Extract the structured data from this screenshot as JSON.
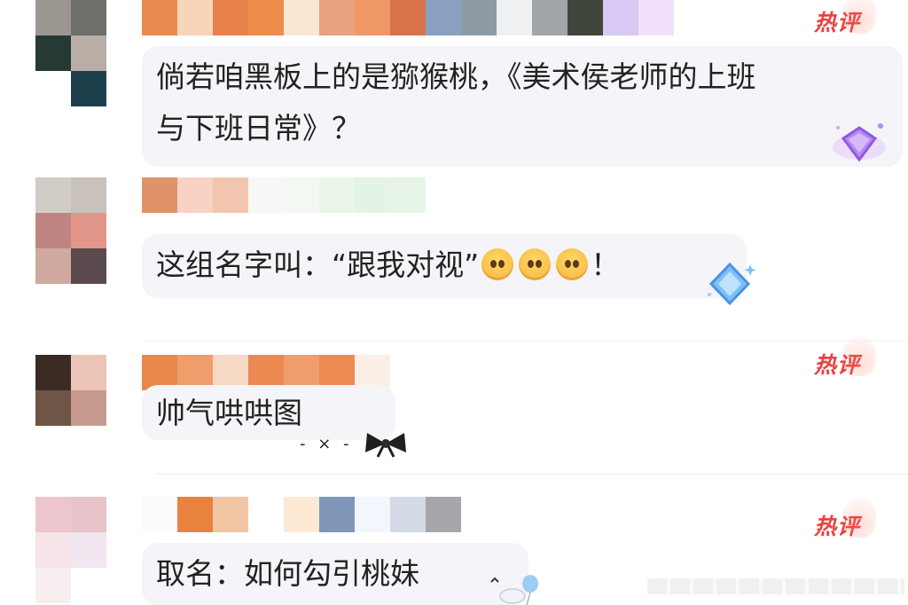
{
  "comments": [
    {
      "text": "倘若咱黑板上的是猕猴桃，《美术侯老师的上班",
      "text2": "与下班日常》？",
      "hot_label": "热评",
      "badge": "purple-diamond"
    },
    {
      "text_before": "这组名字叫：“跟我对视”",
      "text_after": "！",
      "badge": "blue-diamond"
    },
    {
      "text": "帅气哄哄图",
      "hot_label": "热评",
      "decoration": "bow"
    },
    {
      "text": "取名：如何勾引桃妹",
      "hot_label": "热评",
      "decoration": "balloon"
    }
  ],
  "decorative_dashes": "- × -",
  "colors": {
    "hot_red": "#e8413e",
    "bubble_bg": "#f5f4f8"
  }
}
